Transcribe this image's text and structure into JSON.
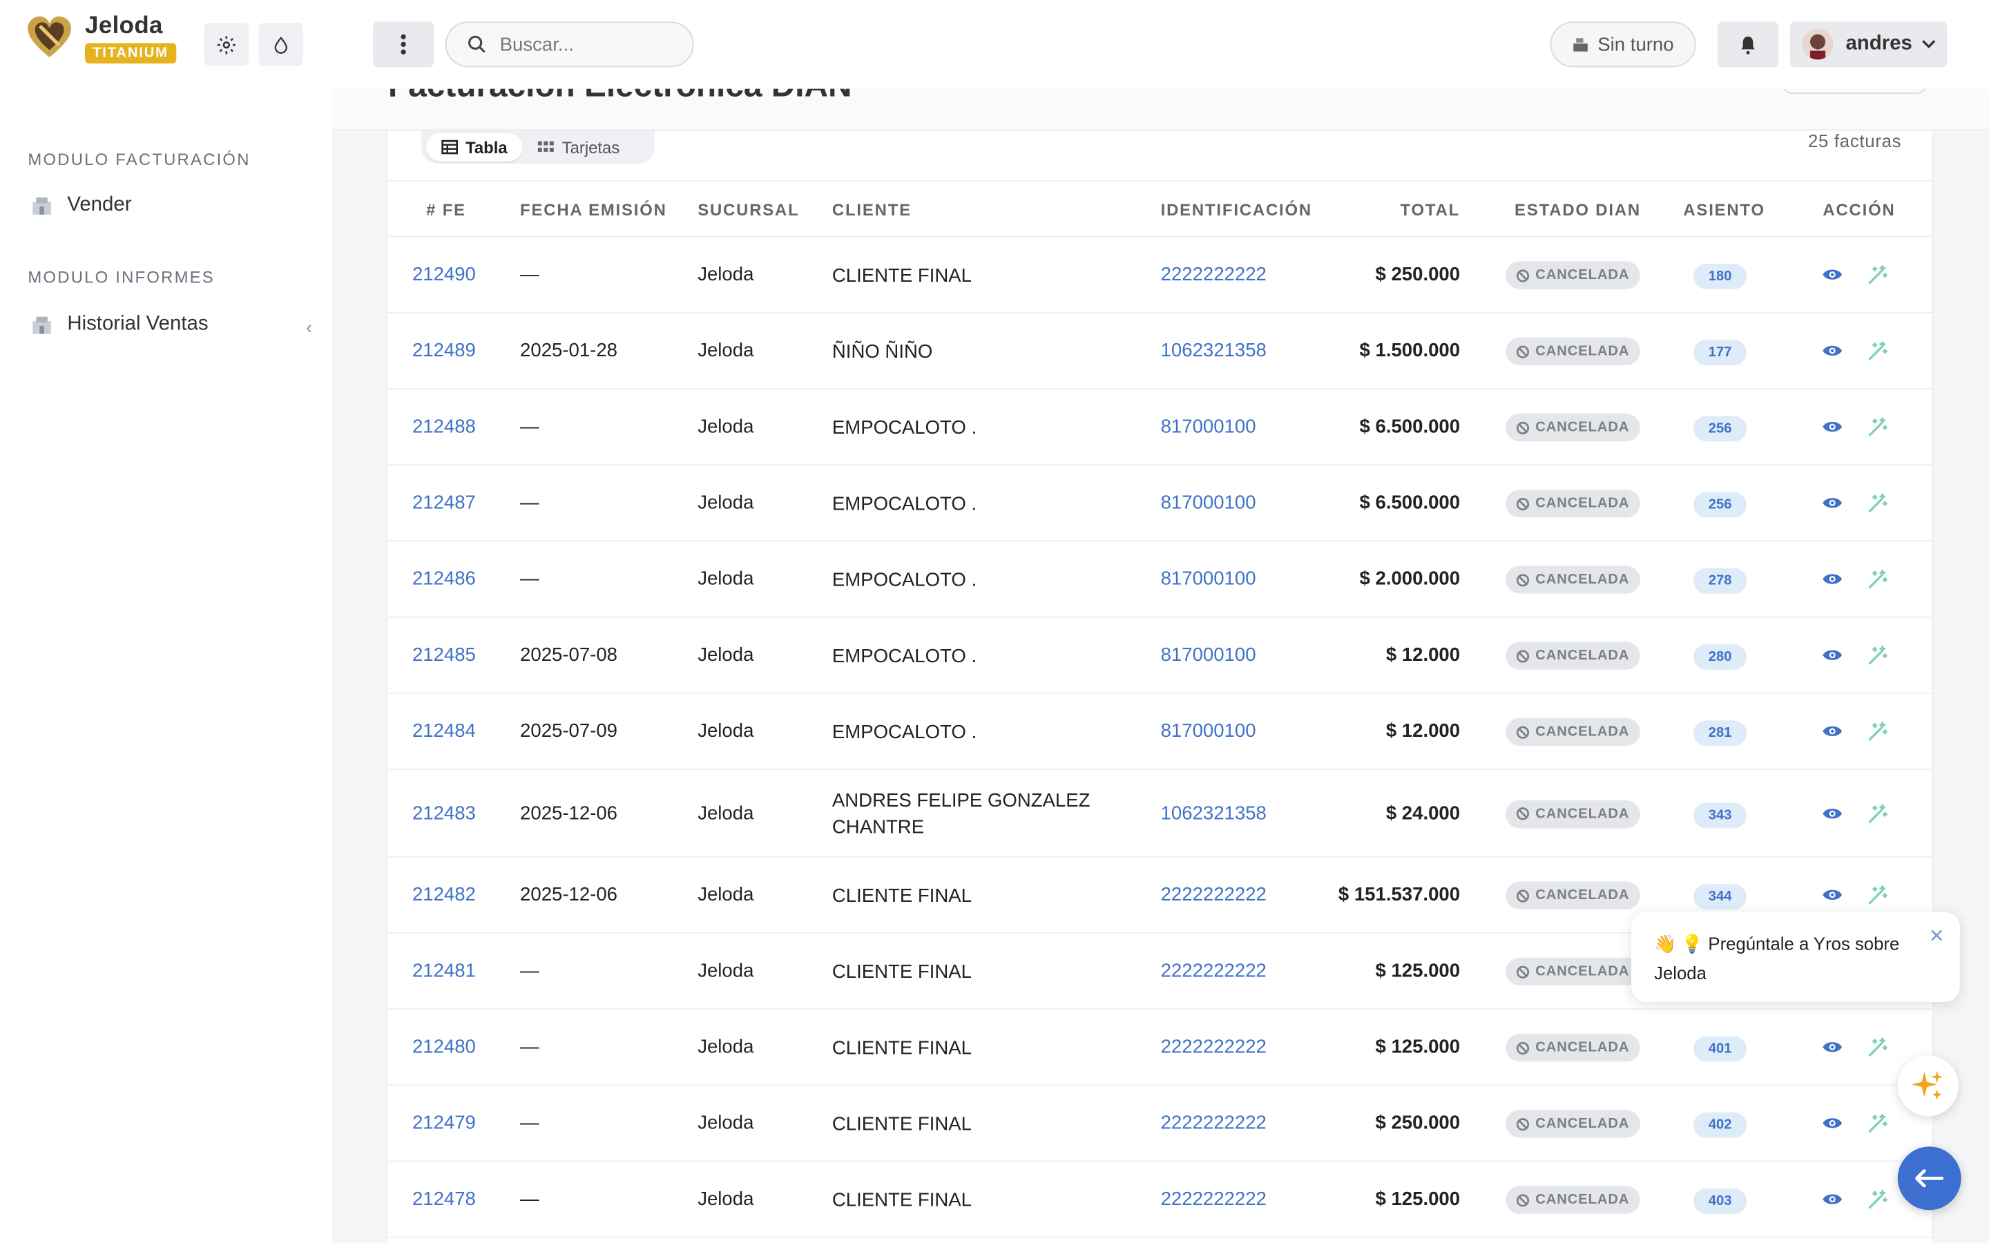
{
  "brand": {
    "name": "Jeloda",
    "badge": "TITANIUM"
  },
  "sidebar": {
    "sections": [
      {
        "title": "MODULO FACTURACIÓN",
        "items": [
          {
            "label": "Vender",
            "icon": "shop-icon"
          }
        ]
      },
      {
        "title": "MODULO INFORMES",
        "items": [
          {
            "label": "Historial Ventas",
            "icon": "shop-icon"
          }
        ]
      }
    ]
  },
  "header": {
    "search_placeholder": "Buscar...",
    "turno_label": "Sin turno",
    "user_name": "andres"
  },
  "page": {
    "title": "Facturación Electrónica DIAN",
    "view_tabs": [
      {
        "label": "Tabla",
        "active": true
      },
      {
        "label": "Tarjetas",
        "active": false
      }
    ],
    "count_label": "25 facturas"
  },
  "table": {
    "columns": [
      "# FE",
      "FECHA EMISIÓN",
      "SUCURSAL",
      "CLIENTE",
      "IDENTIFICACIÓN",
      "TOTAL",
      "ESTADO DIAN",
      "ASIENTO",
      "ACCIÓN"
    ],
    "status_label": "CANCELADA",
    "rows": [
      {
        "fe": "212490",
        "fecha": "—",
        "sucursal": "Jeloda",
        "cliente": "CLIENTE FINAL",
        "id": "2222222222",
        "total": "$ 250.000",
        "estado": "CANCELADA",
        "asiento": "180"
      },
      {
        "fe": "212489",
        "fecha": "2025-01-28",
        "sucursal": "Jeloda",
        "cliente": "ÑIÑO ÑIÑO",
        "id": "1062321358",
        "total": "$ 1.500.000",
        "estado": "CANCELADA",
        "asiento": "177"
      },
      {
        "fe": "212488",
        "fecha": "—",
        "sucursal": "Jeloda",
        "cliente": "EMPOCALOTO .",
        "id": "817000100",
        "total": "$ 6.500.000",
        "estado": "CANCELADA",
        "asiento": "256"
      },
      {
        "fe": "212487",
        "fecha": "—",
        "sucursal": "Jeloda",
        "cliente": "EMPOCALOTO .",
        "id": "817000100",
        "total": "$ 6.500.000",
        "estado": "CANCELADA",
        "asiento": "256"
      },
      {
        "fe": "212486",
        "fecha": "—",
        "sucursal": "Jeloda",
        "cliente": "EMPOCALOTO .",
        "id": "817000100",
        "total": "$ 2.000.000",
        "estado": "CANCELADA",
        "asiento": "278"
      },
      {
        "fe": "212485",
        "fecha": "2025-07-08",
        "sucursal": "Jeloda",
        "cliente": "EMPOCALOTO .",
        "id": "817000100",
        "total": "$ 12.000",
        "estado": "CANCELADA",
        "asiento": "280"
      },
      {
        "fe": "212484",
        "fecha": "2025-07-09",
        "sucursal": "Jeloda",
        "cliente": "EMPOCALOTO .",
        "id": "817000100",
        "total": "$ 12.000",
        "estado": "CANCELADA",
        "asiento": "281"
      },
      {
        "fe": "212483",
        "fecha": "2025-12-06",
        "sucursal": "Jeloda",
        "cliente": "ANDRES FELIPE GONZALEZ CHANTRE",
        "id": "1062321358",
        "total": "$ 24.000",
        "estado": "CANCELADA",
        "asiento": "343"
      },
      {
        "fe": "212482",
        "fecha": "2025-12-06",
        "sucursal": "Jeloda",
        "cliente": "CLIENTE FINAL",
        "id": "2222222222",
        "total": "$ 151.537.000",
        "estado": "CANCELADA",
        "asiento": "344"
      },
      {
        "fe": "212481",
        "fecha": "—",
        "sucursal": "Jeloda",
        "cliente": "CLIENTE FINAL",
        "id": "2222222222",
        "total": "$ 125.000",
        "estado": "CANCELADA",
        "asiento": ""
      },
      {
        "fe": "212480",
        "fecha": "—",
        "sucursal": "Jeloda",
        "cliente": "CLIENTE FINAL",
        "id": "2222222222",
        "total": "$ 125.000",
        "estado": "CANCELADA",
        "asiento": "401"
      },
      {
        "fe": "212479",
        "fecha": "—",
        "sucursal": "Jeloda",
        "cliente": "CLIENTE FINAL",
        "id": "2222222222",
        "total": "$ 250.000",
        "estado": "CANCELADA",
        "asiento": "402"
      },
      {
        "fe": "212478",
        "fecha": "—",
        "sucursal": "Jeloda",
        "cliente": "CLIENTE FINAL",
        "id": "2222222222",
        "total": "$ 125.000",
        "estado": "CANCELADA",
        "asiento": "403"
      }
    ]
  },
  "assistant": {
    "message": "👋 💡 Pregúntale a Yros sobre Jeloda"
  },
  "colors": {
    "accent": "#3f72c7",
    "badge_gold": "#e6b31e",
    "fab_blue": "#3c6fcf"
  }
}
